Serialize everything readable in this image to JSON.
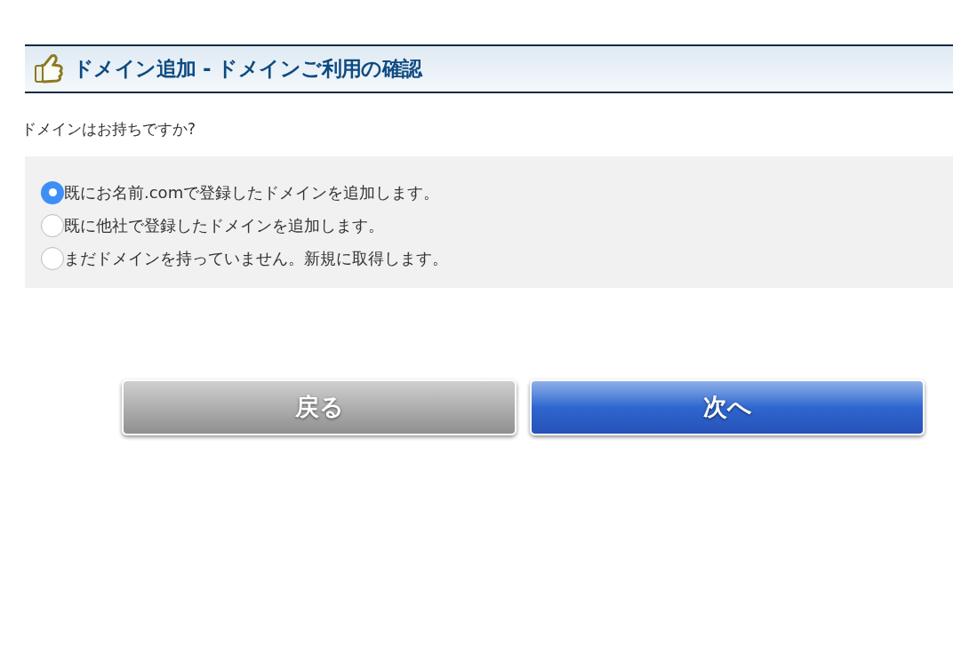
{
  "header": {
    "title": "ドメイン追加 - ドメインご利用の確認"
  },
  "question": "ドメインはお持ちですか?",
  "options": [
    {
      "label": "既にお名前.comで登録したドメインを追加します。",
      "selected": true
    },
    {
      "label": "既に他社で登録したドメインを追加します。",
      "selected": false
    },
    {
      "label": "まだドメインを持っていません。新規に取得します。",
      "selected": false
    }
  ],
  "buttons": [
    {
      "label": "戻る",
      "kind": "back"
    },
    {
      "label": "次へ",
      "kind": "next"
    }
  ]
}
